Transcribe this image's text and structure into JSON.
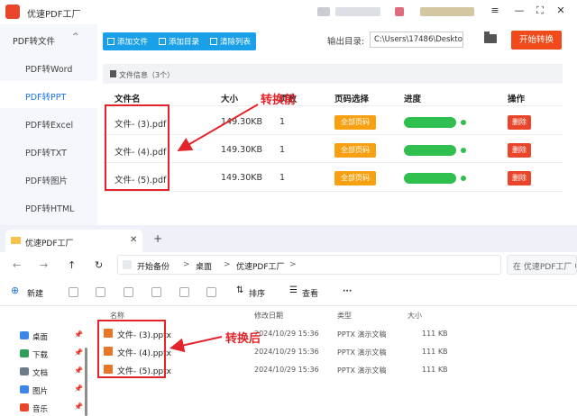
{
  "app": {
    "title": "优速PDF工厂",
    "window_controls": {
      "menu": "≡",
      "minimize": "—",
      "maximize": "⛶",
      "close": "✕"
    },
    "sidebar": {
      "group_label": "PDF转文件",
      "group_chevron": "^",
      "items": [
        {
          "label": "PDF转Word"
        },
        {
          "label": "PDF转PPT"
        },
        {
          "label": "PDF转Excel"
        },
        {
          "label": "PDF转TXT"
        },
        {
          "label": "PDF转图片"
        },
        {
          "label": "PDF转HTML"
        }
      ]
    },
    "toolbar": {
      "add_file": "添加文件",
      "add_folder": "添加目录",
      "clear_list": "清除列表"
    },
    "output": {
      "label": "输出目录:",
      "path": "C:\\Users\\17486\\Deskto"
    },
    "start_button": "开始转换",
    "panel": {
      "header": "文件信息（3个）"
    },
    "columns": [
      "文件名",
      "大小",
      "页数",
      "页码选择",
      "进度",
      "操作"
    ],
    "rows": [
      {
        "name": "文件- (3).pdf",
        "size": "149.30KB",
        "pages": "1",
        "page_select": "全部页码",
        "progress": 1.0,
        "action": "删除"
      },
      {
        "name": "文件- (4).pdf",
        "size": "149.30KB",
        "pages": "1",
        "page_select": "全部页码",
        "progress": 1.0,
        "action": "删除"
      },
      {
        "name": "文件- (5).pdf",
        "size": "149.30KB",
        "pages": "1",
        "page_select": "全部页码",
        "progress": 1.0,
        "action": "删除"
      }
    ]
  },
  "annotations": {
    "before": "转换前",
    "after": "转换后"
  },
  "explorer": {
    "tab_label": "优速PDF工厂",
    "tab_close": "✕",
    "new_tab": "+",
    "nav": {
      "back": "←",
      "forward": "→",
      "up": "↑",
      "refresh": "↻"
    },
    "breadcrumb": [
      "开始备份",
      "桌面",
      "优速PDF工厂"
    ],
    "crumb_sep": ">",
    "search_placeholder": "在 优速PDF工厂 中",
    "commands": {
      "new": "新建",
      "sort": "排序",
      "view": "查看",
      "more": "···"
    },
    "nav_items": [
      {
        "label": "桌面",
        "color": "#3d86e8"
      },
      {
        "label": "下载",
        "color": "#2f9e5b"
      },
      {
        "label": "文档",
        "color": "#6c7a8a"
      },
      {
        "label": "图片",
        "color": "#3d86e8"
      },
      {
        "label": "音乐",
        "color": "#e8452a"
      }
    ],
    "pin_glyph": "📌",
    "file_columns": [
      "名称",
      "修改日期",
      "类型",
      "大小"
    ],
    "files": [
      {
        "name": "文件- (3).pptx",
        "date": "2024/10/29 15:36",
        "type": "PPTX 演示文稿",
        "size": "111 KB"
      },
      {
        "name": "文件- (4).pptx",
        "date": "2024/10/29 15:36",
        "type": "PPTX 演示文稿",
        "size": "111 KB"
      },
      {
        "name": "文件- (5).pptx",
        "date": "2024/10/29 15:36",
        "type": "PPTX 演示文稿",
        "size": "111 KB"
      }
    ]
  },
  "colors": {
    "accent": "#1aa0e8",
    "start": "#f04a1b",
    "progress": "#2fbf4f",
    "badge": "#f6a012",
    "danger": "#e8452a",
    "annotation": "#e3242b"
  }
}
